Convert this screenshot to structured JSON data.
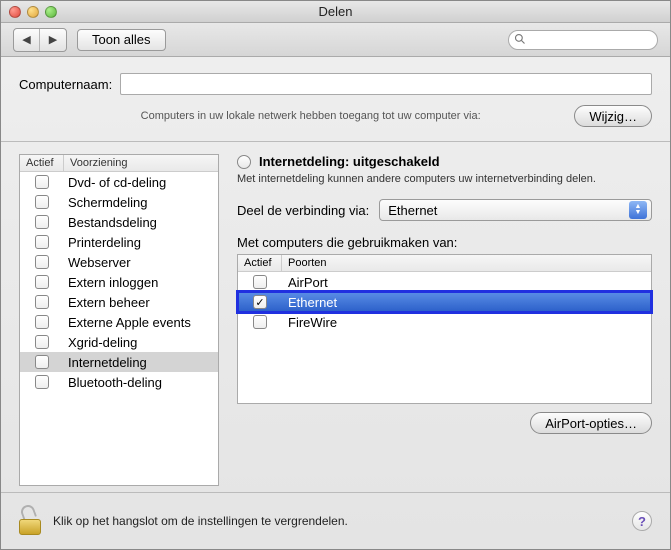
{
  "window": {
    "title": "Delen"
  },
  "toolbar": {
    "show_all": "Toon alles",
    "search_placeholder": ""
  },
  "computer_name": {
    "label": "Computernaam:",
    "value": "",
    "hint": "Computers in uw lokale netwerk hebben toegang tot uw computer via:",
    "edit_button": "Wijzig…"
  },
  "services": {
    "headers": {
      "active": "Actief",
      "service": "Voorziening"
    },
    "items": [
      {
        "label": "Dvd- of cd-deling",
        "checked": false
      },
      {
        "label": "Schermdeling",
        "checked": false
      },
      {
        "label": "Bestandsdeling",
        "checked": false
      },
      {
        "label": "Printerdeling",
        "checked": false
      },
      {
        "label": "Webserver",
        "checked": false
      },
      {
        "label": "Extern inloggen",
        "checked": false
      },
      {
        "label": "Extern beheer",
        "checked": false
      },
      {
        "label": "Externe Apple events",
        "checked": false
      },
      {
        "label": "Xgrid-deling",
        "checked": false
      },
      {
        "label": "Internetdeling",
        "checked": false,
        "selected": true
      },
      {
        "label": "Bluetooth-deling",
        "checked": false
      }
    ]
  },
  "detail": {
    "status_title": "Internetdeling: uitgeschakeld",
    "status_desc": "Met internetdeling kunnen andere computers uw internetverbinding delen.",
    "share_label": "Deel de verbinding via:",
    "share_value": "Ethernet",
    "ports_label": "Met computers die gebruikmaken van:",
    "ports_headers": {
      "active": "Actief",
      "ports": "Poorten"
    },
    "ports": [
      {
        "label": "AirPort",
        "checked": false
      },
      {
        "label": "Ethernet",
        "checked": true,
        "highlighted": true
      },
      {
        "label": "FireWire",
        "checked": false
      }
    ],
    "airport_button": "AirPort-opties…"
  },
  "lock": {
    "text": "Klik op het hangslot om de instellingen te vergrendelen."
  }
}
